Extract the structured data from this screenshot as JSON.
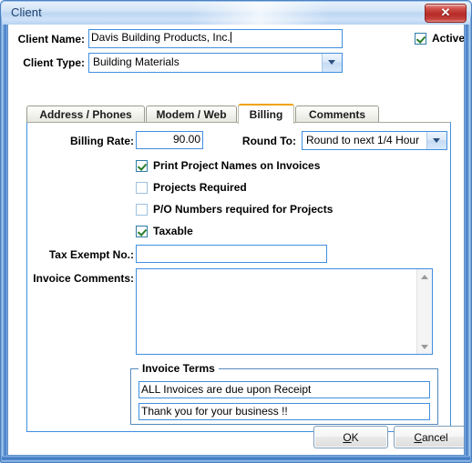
{
  "window": {
    "title": "Client",
    "close_label": "✕"
  },
  "header": {
    "client_name_label": "Client Name:",
    "client_name_value": "Davis Building Products, Inc.",
    "client_type_label": "Client Type:",
    "client_type_value": "Building Materials",
    "active_label": "Active",
    "active_checked": true
  },
  "tabs": [
    {
      "label": "Address / Phones",
      "active": false
    },
    {
      "label": "Modem / Web",
      "active": false
    },
    {
      "label": "Billing",
      "active": true
    },
    {
      "label": "Comments",
      "active": false
    }
  ],
  "billing": {
    "billing_rate_label": "Billing Rate:",
    "billing_rate_value": "90.00",
    "round_to_label": "Round To:",
    "round_to_value": "Round to next 1/4 Hour",
    "checkboxes": [
      {
        "label": "Print Project Names on Invoices",
        "checked": true
      },
      {
        "label": "Projects Required",
        "checked": false
      },
      {
        "label": "P/O Numbers required for Projects",
        "checked": false
      },
      {
        "label": "Taxable",
        "checked": true
      }
    ],
    "tax_exempt_label": "Tax Exempt No.:",
    "tax_exempt_value": "",
    "invoice_comments_label": "Invoice Comments:",
    "invoice_comments_value": "",
    "invoice_terms": {
      "title": "Invoice Terms",
      "line1": "ALL Invoices are due upon Receipt",
      "line2": "Thank you for your business !!"
    }
  },
  "footer": {
    "ok_mnemonic": "O",
    "ok_rest": "K",
    "cancel_mnemonic": "C",
    "cancel_rest": "ancel"
  },
  "colors": {
    "accent_blue": "#3f8fe0",
    "active_tab_top": "#f0a30a",
    "check_green": "#2a7d2a",
    "close_red": "#b52b27"
  }
}
